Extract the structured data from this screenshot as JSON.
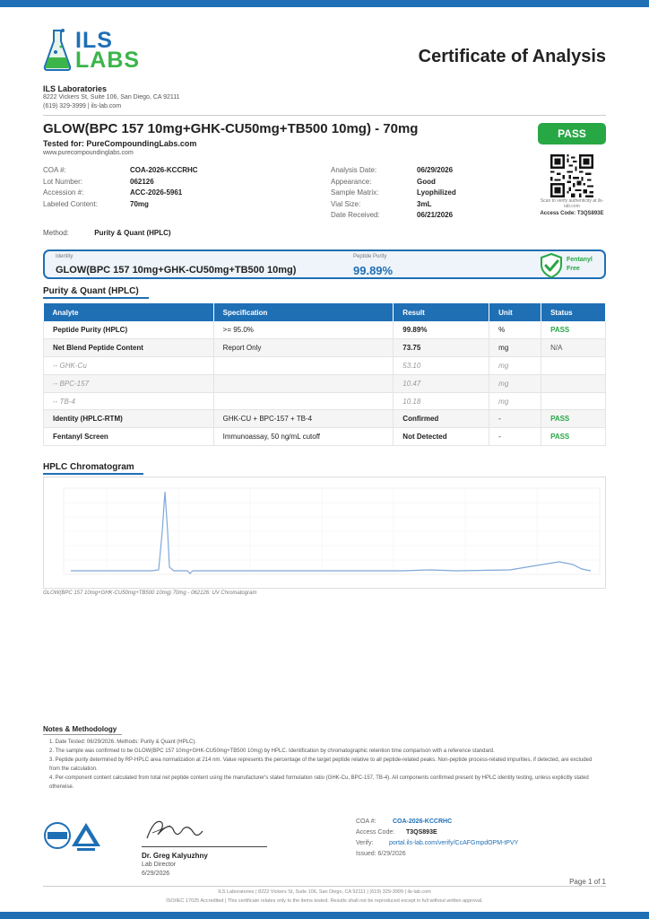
{
  "header": {
    "logo_top": "ILS",
    "logo_bottom": "LABS",
    "doc_title": "Certificate of Analysis",
    "lab_name": "ILS Laboratories",
    "lab_address": "8222 Vickers St, Suite 106, San Diego, CA 92111",
    "lab_contact": "(619) 329-3999  |  ils-lab.com"
  },
  "product": {
    "title": "GLOW(BPC 157 10mg+GHK-CU50mg+TB500 10mg) - 70mg",
    "tested_for": "Tested for: PureCompoundingLabs.com",
    "client_url": "www.purecompoundinglabs.com",
    "status": "PASS"
  },
  "meta_left": [
    {
      "label": "COA #:",
      "value": "COA-2026-KCCRHC"
    },
    {
      "label": "Lot Number:",
      "value": "062126"
    },
    {
      "label": "Accession #:",
      "value": "ACC-2026-5961"
    },
    {
      "label": "Labeled Content:",
      "value": "70mg"
    }
  ],
  "meta_right": [
    {
      "label": "Analysis Date:",
      "value": "06/29/2026"
    },
    {
      "label": "Appearance:",
      "value": "Good"
    },
    {
      "label": "Sample Matrix:",
      "value": "Lyophilized"
    },
    {
      "label": "Vial Size:",
      "value": "3mL"
    },
    {
      "label": "Date Received:",
      "value": "06/21/2026"
    }
  ],
  "qr": {
    "note": "Scan to verify authenticity at ils-lab.com",
    "access_code": "Access Code: T3QS893E"
  },
  "method": {
    "label": "Method:",
    "value": "Purity & Quant (HPLC)"
  },
  "identity_box": {
    "identity_label": "Identity",
    "identity_value": "GLOW(BPC 157 10mg+GHK-CU50mg+TB500 10mg)",
    "purity_label": "Peptide Purity",
    "purity_value": "99.89%",
    "fentanyl_line1": "Fentanyl",
    "fentanyl_line2": "Free"
  },
  "results": {
    "section_title": "Purity & Quant (HPLC)",
    "headers": [
      "Analyte",
      "Specification",
      "Result",
      "Unit",
      "Status"
    ],
    "rows": [
      {
        "analyte": "Peptide Purity (HPLC)",
        "spec": ">= 95.0%",
        "result": "99.89%",
        "unit": "%",
        "status": "PASS",
        "kind": "main"
      },
      {
        "analyte": "Net Blend Peptide Content",
        "spec": "Report Only",
        "result": "73.75",
        "unit": "mg",
        "status": "N/A",
        "kind": "main"
      },
      {
        "analyte": "-- GHK-Cu",
        "spec": "",
        "result": "53.10",
        "unit": "mg",
        "status": "",
        "kind": "sub"
      },
      {
        "analyte": "-- BPC-157",
        "spec": "",
        "result": "10.47",
        "unit": "mg",
        "status": "",
        "kind": "sub"
      },
      {
        "analyte": "-- TB-4",
        "spec": "",
        "result": "10.18",
        "unit": "mg",
        "status": "",
        "kind": "sub"
      },
      {
        "analyte": "Identity (HPLC-RTM)",
        "spec": "GHK-CU + BPC-157 + TB-4",
        "result": "Confirmed",
        "unit": "-",
        "status": "PASS",
        "kind": "main"
      },
      {
        "analyte": "Fentanyl Screen",
        "spec": "Immunoassay, 50 ng/mL cutoff",
        "result": "Not Detected",
        "unit": "-",
        "status": "PASS",
        "kind": "main"
      }
    ]
  },
  "chromatogram": {
    "section_title": "HPLC Chromatogram",
    "caption": "GLOW(BPC 157 10mg+GHK-CU50mg+TB500 10mg) 70mg - 062126: UV Chromatogram"
  },
  "notes": {
    "title": "Notes & Methodology",
    "items": [
      "1. Date Tested: 06/29/2026. Methods: Purity & Quant (HPLC).",
      "2. The sample was confirmed to be GLOW(BPC 157 10mg+GHK-CU50mg+TB500 10mg) by HPLC. Identification by chromatographic retention time comparison with a reference standard.",
      "3. Peptide purity determined by RP-HPLC area normalization at 214 nm. Value represents the percentage of the target peptide relative to all peptide-related peaks. Non-peptide process-related impurities, if detected, are excluded from the calculation.",
      "4. Per-component content calculated from total net peptide content using the manufacturer's stated formulation ratio (GHK-Cu, BPC-157, TB-4). All components confirmed present by HPLC identity testing, unless explicitly stated otherwise."
    ]
  },
  "signature": {
    "name": "Dr. Greg Kalyuzhny",
    "role": "Lab Director",
    "date": "6/29/2026"
  },
  "footer_meta": {
    "coa_label": "COA #:",
    "coa_value": "COA-2026-KCCRHC",
    "access_label": "Access Code:",
    "access_value": "T3QS893E",
    "verify_label": "Verify:",
    "verify_value": "portal.ils-lab.com/verify/CcAFGmpdOPM-tPVY",
    "issued": "Issued: 6/29/2026"
  },
  "footer": {
    "page": "Page 1 of 1",
    "line1": "ILS Laboratories  |  8222 Vickers St, Suite 106, San Diego, CA 92111  |  (619) 329-3999  |  ils-lab.com",
    "line2": "ISO/IEC 17025 Accredited  |  This certificate relates only to the items tested. Results shall not be reproduced except in full without written approval."
  },
  "colors": {
    "brand_blue": "#1f6fb5",
    "brand_green": "#3bb54a",
    "pass_green": "#28a745"
  }
}
